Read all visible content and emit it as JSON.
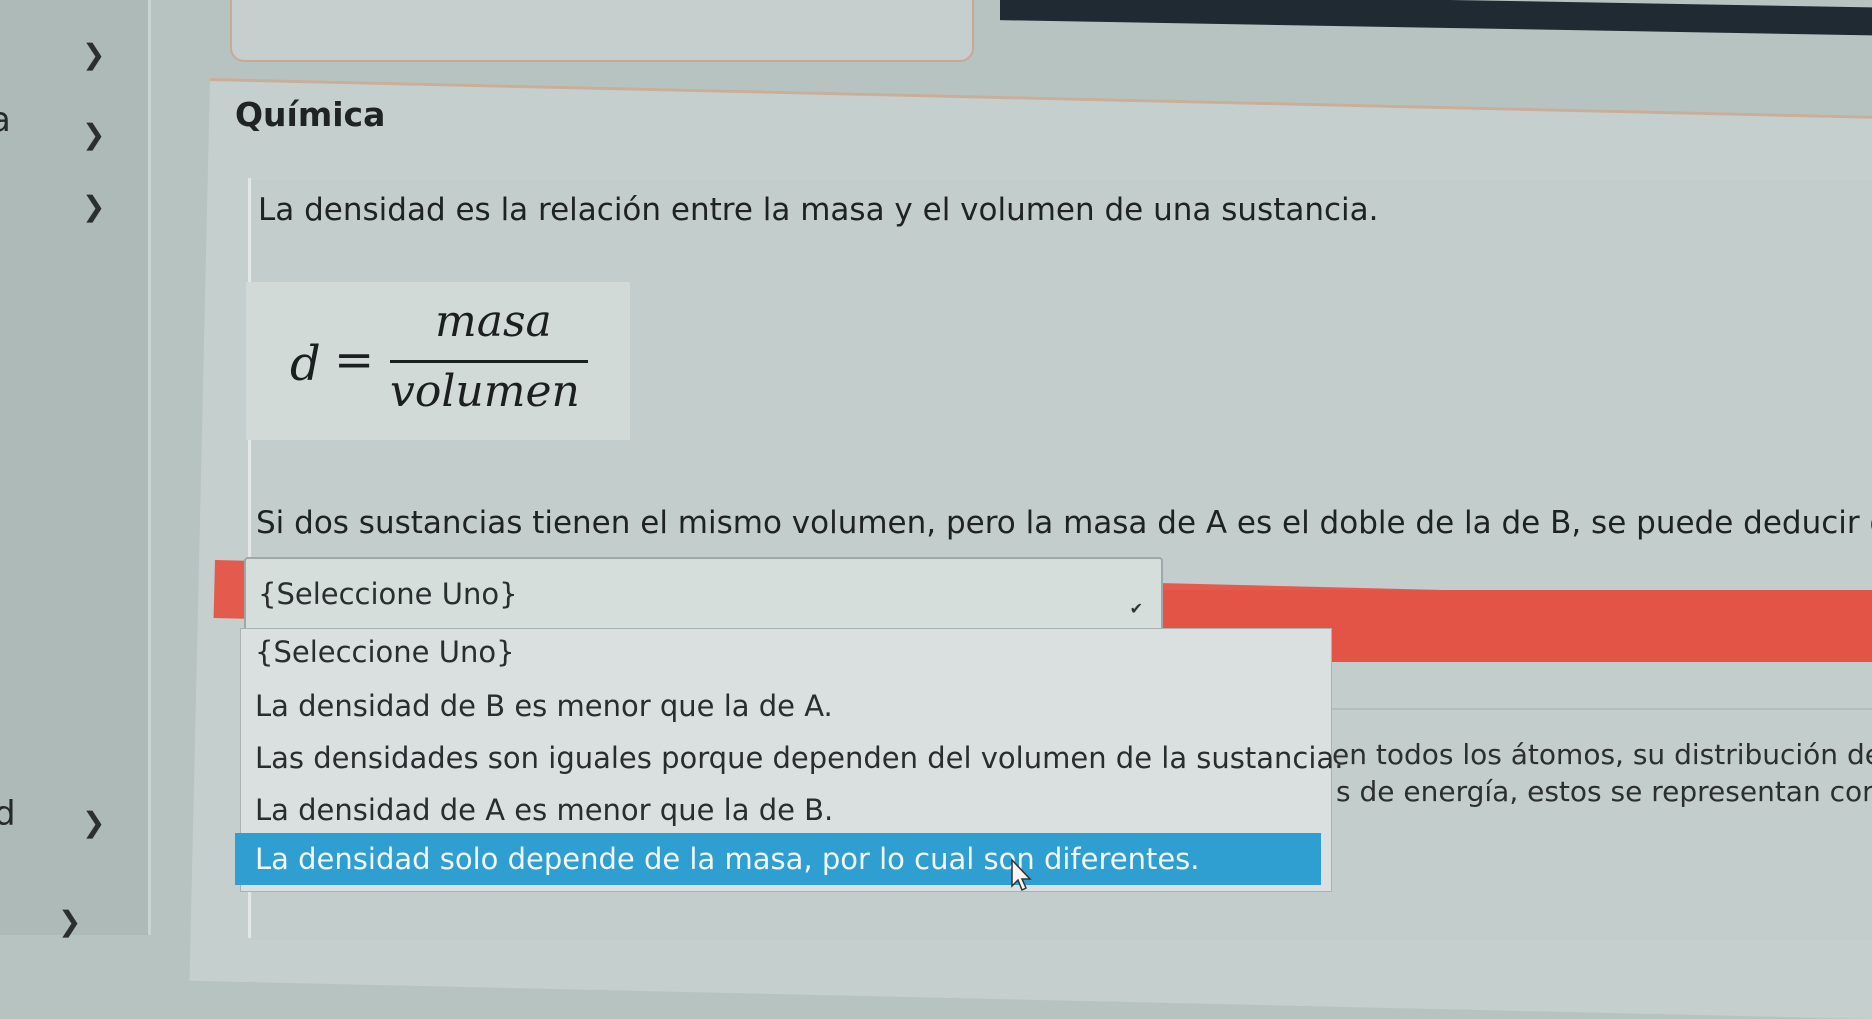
{
  "nav": {
    "item_a": "a",
    "item_d": "d"
  },
  "subject_title": "Química",
  "question": {
    "intro": "La densidad es la relación entre la masa y el volumen de una sustancia.",
    "formula": {
      "lhs": "d",
      "eq": "=",
      "numerator": "masa",
      "denominator": "volumen"
    },
    "prompt": "Si dos sustancias tienen el mismo volumen, pero la masa de A es el doble de la de B, se puede deducir que:"
  },
  "select": {
    "value": "{Seleccione Uno}",
    "options": [
      "{Seleccione Uno}",
      "La densidad de B es menor que la de A.",
      "Las densidades son iguales porque dependen del volumen de la sustancia.",
      "La densidad de A es menor que la de B.",
      "La densidad solo depende de la masa, por lo cual son diferentes."
    ],
    "highlighted_index": 4
  },
  "background_text": {
    "line1": "en todos los átomos, su distribución de",
    "line2": "s de energía, estos se representan con la"
  },
  "colors": {
    "error_band": "#e45a4d",
    "highlight": "#2e9fd0",
    "border_accent": "#c9ae99"
  }
}
